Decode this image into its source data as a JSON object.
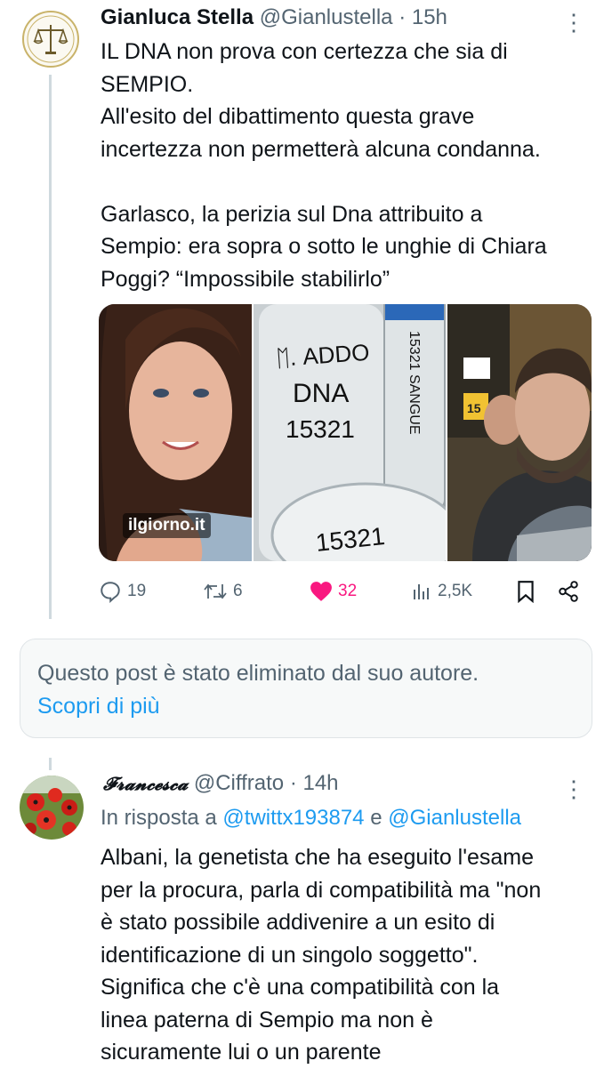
{
  "tweet1": {
    "author_name": "Gianluca Stella",
    "handle": "@Gianlustella",
    "time": "· 15h",
    "text": "IL DNA non prova con certezza che sia di\nSEMPIO.\nAll'esito del dibattimento questa grave\nincertezza non permetterà alcuna condanna.\n\nGarlasco, la perizia sul Dna attribuito a\nSempio: era sopra o sotto le unghie di Chiara\nPoggi? “Impossibile stabilirlo”",
    "media_source_tag": "ilgiorno.it",
    "media_labels": {
      "tube_text": "ᛖ. ADDO\nDNA\n15321",
      "tube2_text": "15321 SANGUE",
      "lid_text": "15321",
      "sign_number": "15"
    },
    "actions": {
      "replies": "19",
      "reposts": "6",
      "likes": "32",
      "views": "2,5K"
    },
    "icons": [
      "reply-icon",
      "repost-icon",
      "heart-icon",
      "views-icon",
      "bookmark-icon",
      "share-icon"
    ],
    "colors": {
      "like_active": "#f91880",
      "muted": "#536471"
    }
  },
  "deleted_post": {
    "message": "Questo post è stato eliminato dal suo autore.",
    "link": "Scopri di più"
  },
  "tweet2": {
    "author_name": "𝓕𝓻𝓪𝓷𝓬𝓮𝓼𝓬𝓪",
    "handle": "@Ciffrato",
    "time": "· 14h",
    "reply_prefix": "In risposta a",
    "reply_user1": "@twittx193874",
    "reply_and": "e",
    "reply_user2": "@Gianlustella",
    "text": "Albani, la genetista che ha eseguito l'esame\nper la procura, parla di compatibilità ma \"non\nè stato possibile addivenire a un esito di\nidentificazione di un singolo soggetto\".\nSignifica che c'è una compatibilità con la\nlinea paterna di Sempio ma non è\nsicuramente lui o un parente"
  },
  "more_glyph": "⋮"
}
